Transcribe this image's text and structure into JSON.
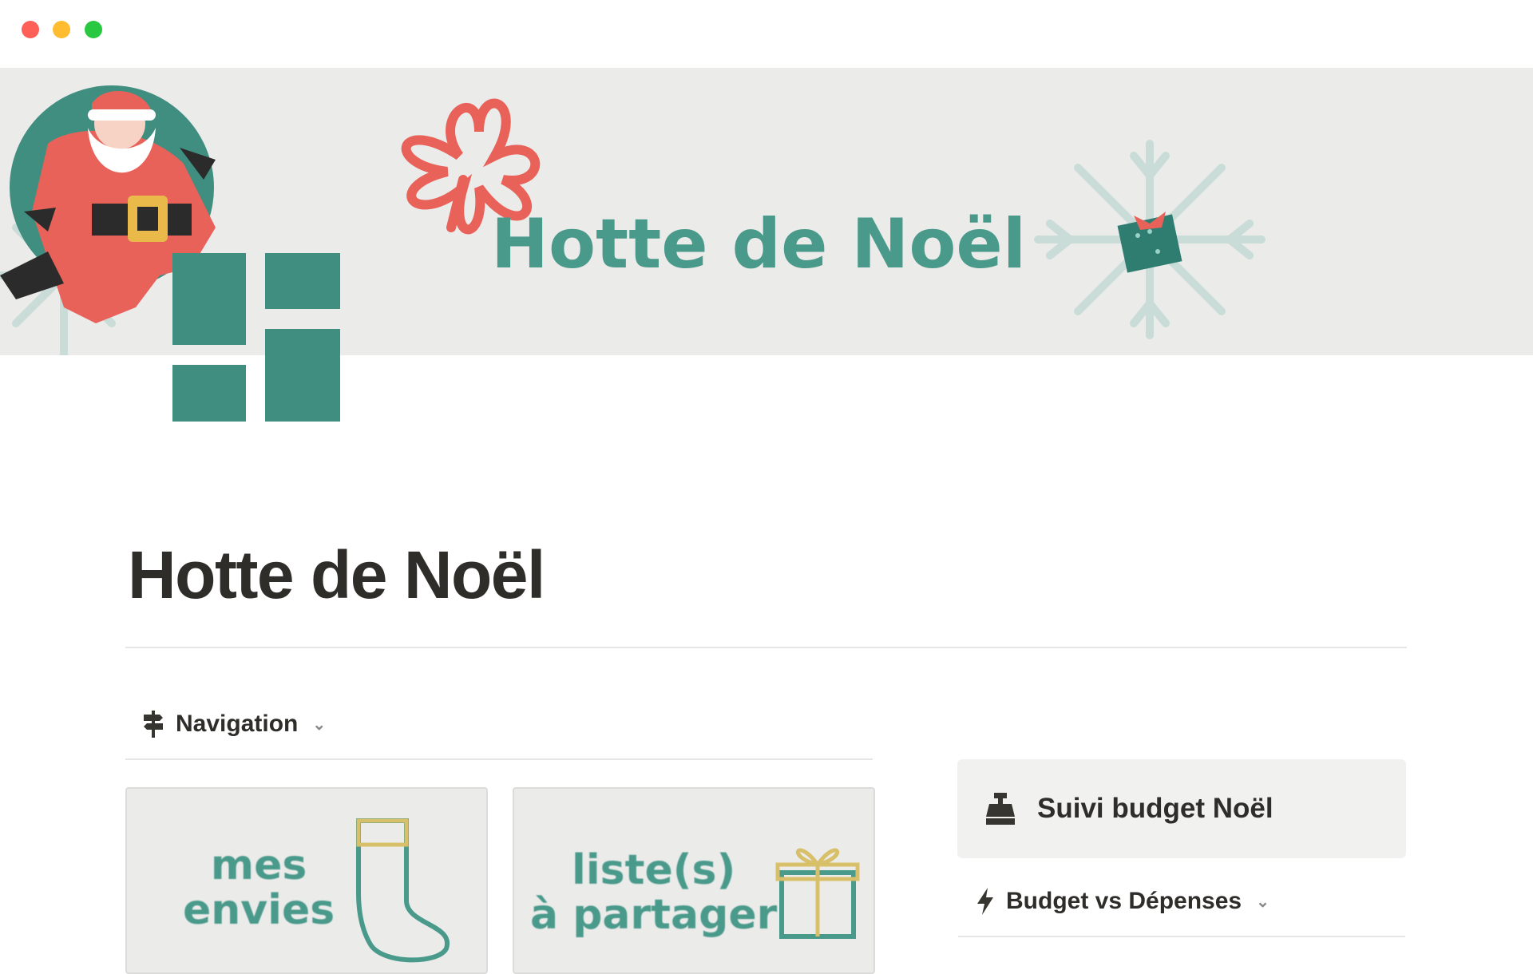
{
  "window": {
    "controls": [
      "close",
      "minimize",
      "maximize"
    ]
  },
  "cover": {
    "banner_text": "Hotte de Noël",
    "accent_color": "#4a9a8b",
    "ribbon_color": "#e8625a"
  },
  "page": {
    "title": "Hotte de Noël",
    "icon": "grid-blocks-icon"
  },
  "navigation": {
    "label": "Navigation",
    "icon": "signpost-icon",
    "cards": [
      {
        "lines": [
          "mes",
          "envies"
        ],
        "icon": "stocking-icon"
      },
      {
        "lines": [
          "liste(s)",
          "à partager"
        ],
        "icon": "gift-box-icon"
      }
    ]
  },
  "callout": {
    "label": "Suivi budget Noël",
    "icon": "cash-register-icon"
  },
  "budget_toggle": {
    "label": "Budget vs Dépenses",
    "icon": "lightning-icon"
  }
}
